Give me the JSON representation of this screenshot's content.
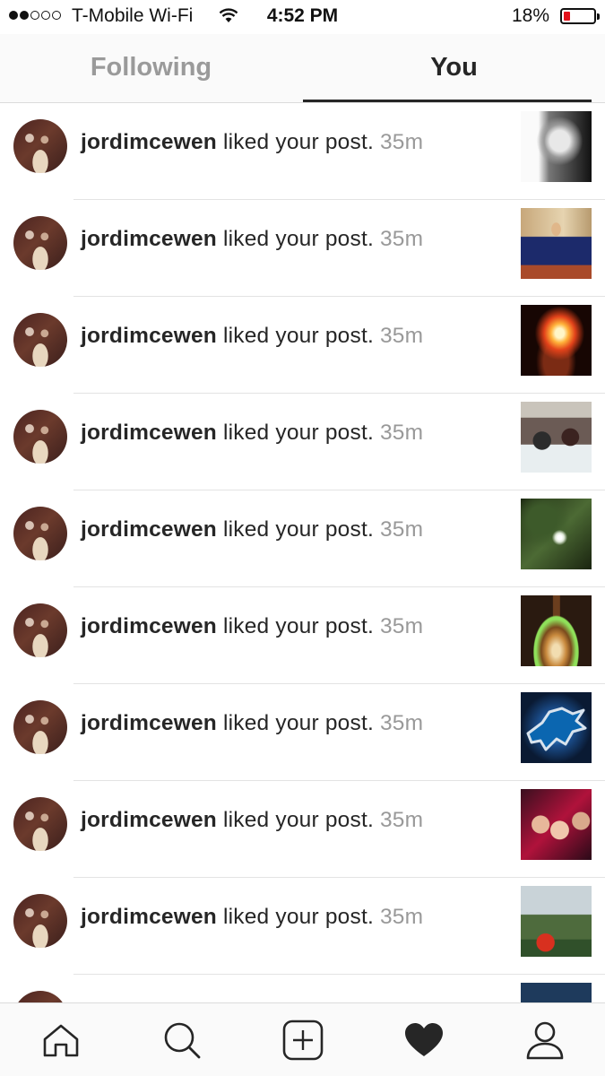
{
  "status_bar": {
    "carrier": "T-Mobile Wi-Fi",
    "time": "4:52 PM",
    "battery": "18%"
  },
  "tabs": [
    {
      "label": "Following",
      "selected": false
    },
    {
      "label": "You",
      "selected": true
    }
  ],
  "notifications": [
    {
      "username": "jordimcewen",
      "action": "liked your post.",
      "time": "35m"
    },
    {
      "username": "jordimcewen",
      "action": "liked your post.",
      "time": "35m"
    },
    {
      "username": "jordimcewen",
      "action": "liked your post.",
      "time": "35m"
    },
    {
      "username": "jordimcewen",
      "action": "liked your post.",
      "time": "35m"
    },
    {
      "username": "jordimcewen",
      "action": "liked your post.",
      "time": "35m"
    },
    {
      "username": "jordimcewen",
      "action": "liked your post.",
      "time": "35m"
    },
    {
      "username": "jordimcewen",
      "action": "liked your post.",
      "time": "35m"
    },
    {
      "username": "jordimcewen",
      "action": "liked your post.",
      "time": "35m"
    },
    {
      "username": "jordimcewen",
      "action": "liked your post.",
      "time": "35m"
    }
  ],
  "bottom_nav": {
    "items": [
      "home-icon",
      "search-icon",
      "add-post-icon",
      "heart-icon",
      "profile-icon"
    ],
    "active": "heart-icon"
  },
  "colors": {
    "text": "#262626",
    "muted": "#999999",
    "tab_inactive": "#9a9a9a",
    "battery_low": "#e3111b"
  }
}
